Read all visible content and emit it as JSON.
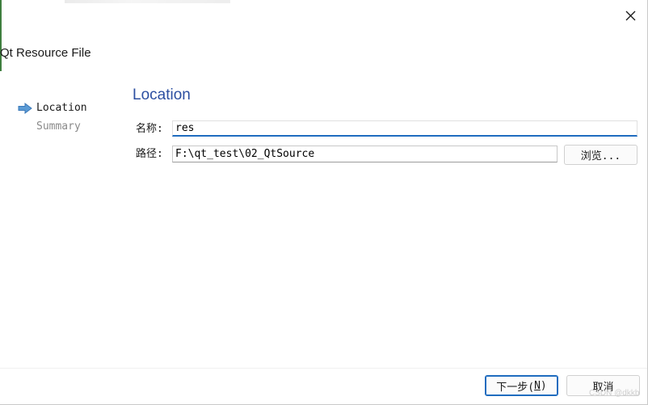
{
  "window": {
    "page_header": "Qt Resource File",
    "close_icon": "close-icon"
  },
  "steps": [
    {
      "label": "Location",
      "active": true,
      "icon": "arrow-right-icon"
    },
    {
      "label": "Summary",
      "active": false
    }
  ],
  "location": {
    "title": "Location",
    "name_label": "名称:",
    "name_value": "res",
    "path_label": "路径:",
    "path_value": "F:\\qt_test\\02_QtSource",
    "browse_label": "浏览..."
  },
  "footer": {
    "next_label_prefix": "下一步(",
    "next_mnemonic": "N",
    "next_label_suffix": ")",
    "cancel_label": "取消"
  },
  "watermark": "CSDN @dkkb",
  "colors": {
    "accent": "#1f6cbf",
    "section_title": "#2c4fa1",
    "inactive_step": "#8a8a8a",
    "arrow_fill": "#5b9bd5"
  }
}
